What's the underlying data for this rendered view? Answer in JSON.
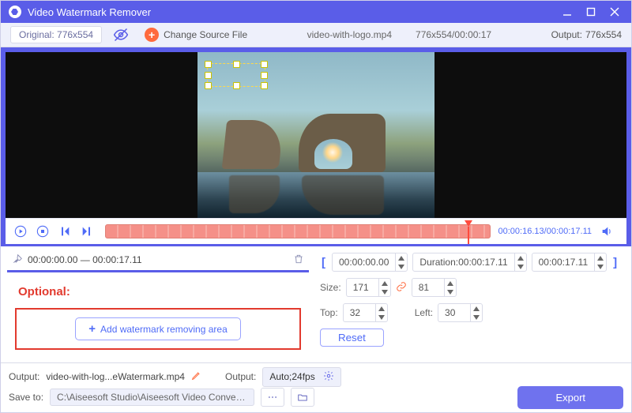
{
  "window": {
    "title": "Video Watermark Remover"
  },
  "infobar": {
    "original_label": "Original:",
    "original_dim": "776x554",
    "change_source": "Change Source File",
    "filename": "video-with-logo.mp4",
    "src_dim_time": "776x554/00:00:17",
    "output_label": "Output:",
    "output_dim": "776x554"
  },
  "playback": {
    "time_current": "00:00:16.13",
    "time_total": "00:00:17.11"
  },
  "segment": {
    "start": "00:00:00.00",
    "sep": "—",
    "end": "00:00:17.11"
  },
  "left": {
    "optional": "Optional:",
    "add_area": "Add watermark removing area"
  },
  "right": {
    "range_start": "00:00:00.00",
    "duration_label": "Duration:",
    "duration_value": "00:00:17.11",
    "range_end": "00:00:17.11",
    "size_label": "Size:",
    "size_w": "171",
    "size_h": "81",
    "top_label": "Top:",
    "top_v": "32",
    "left_label": "Left:",
    "left_v": "30",
    "reset": "Reset"
  },
  "footer": {
    "output_label": "Output:",
    "output_name": "video-with-log...eWatermark.mp4",
    "output_fmt_label": "Output:",
    "output_fmt": "Auto;24fps",
    "save_label": "Save to:",
    "save_path": "C:\\Aiseesoft Studio\\Aiseesoft Video Converter Ultimate\\Video Watermark Remover",
    "export": "Export"
  }
}
